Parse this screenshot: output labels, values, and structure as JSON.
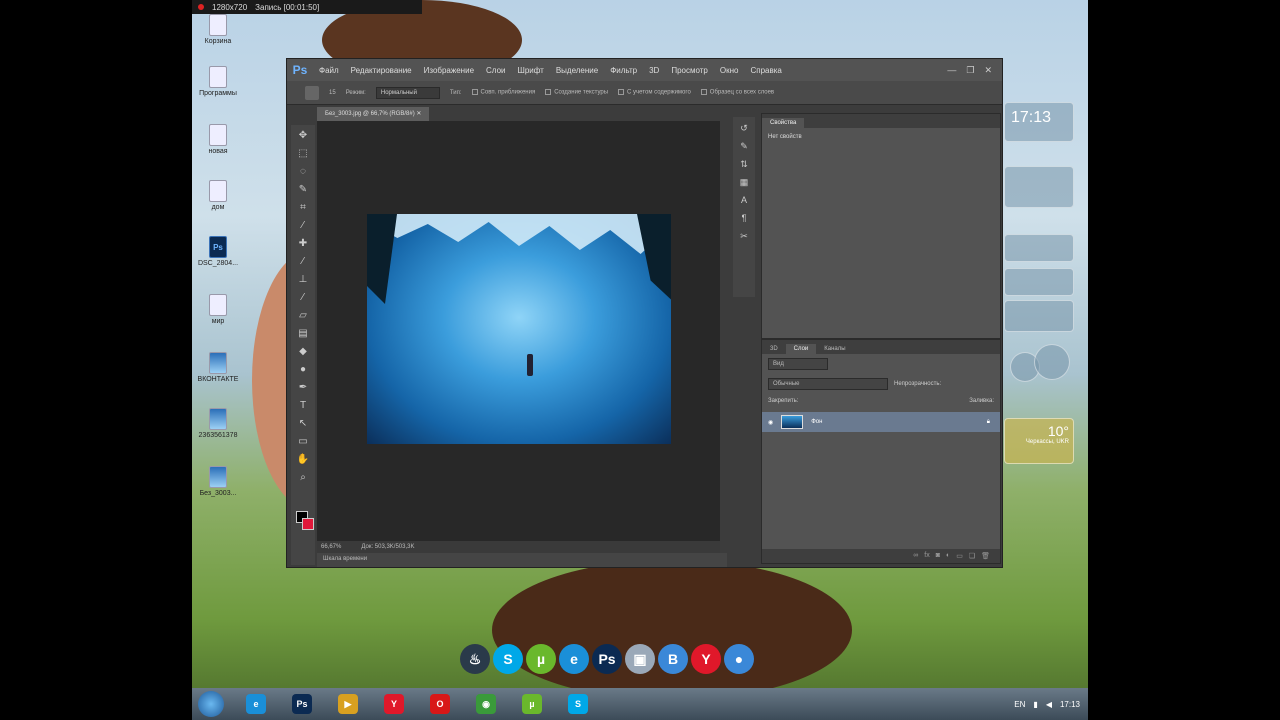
{
  "recorder": {
    "resolution": "1280x720",
    "status": "Запись [00:01:50]"
  },
  "desktop_icons": [
    {
      "label": "Корзина"
    },
    {
      "label": "Программы"
    },
    {
      "label": "новая"
    },
    {
      "label": "дом"
    },
    {
      "label": "DSC_2804..."
    },
    {
      "label": "мир"
    },
    {
      "label": "ВКОНТАКТЕ"
    },
    {
      "label": "2363561378"
    },
    {
      "label": "Без_3003..."
    }
  ],
  "photoshop": {
    "logo": "Ps",
    "menu": [
      "Файл",
      "Редактирование",
      "Изображение",
      "Слои",
      "Шрифт",
      "Выделение",
      "Фильтр",
      "3D",
      "Просмотр",
      "Окно",
      "Справка"
    ],
    "window_buttons": {
      "minimize": "—",
      "restore": "❐",
      "close": "✕"
    },
    "options": {
      "brush_size": "15",
      "mode_label": "Режим:",
      "mode_value": "Нормальный",
      "type_label": "Тип:",
      "check1": "Совп. приближения",
      "check2": "Создание текстуры",
      "check3": "С учетом содержимого",
      "check4": "Образец со всех слоев"
    },
    "doc_tab": "Без_3003.jpg @ 66,7% (RGB/8#) ✕",
    "status": {
      "zoom": "66,67%",
      "doc": "Док: 503,3K/503,3K"
    },
    "timeline_tab": "Шкала времени",
    "props_panel": {
      "tab": "Свойства",
      "body": "Нет свойств"
    },
    "layers_panel": {
      "tabs": [
        "3D",
        "Слои",
        "Каналы"
      ],
      "kind": "Вид",
      "blend": "Обычные",
      "opacity_label": "Непрозрачность:",
      "lock_label": "Закрепить:",
      "fill_label": "Заливка:",
      "layer_name": "Фон"
    }
  },
  "gadgets": {
    "clock": "17:13",
    "weather_temp": "10°",
    "weather_city": "Черкассы, UKR"
  },
  "dock": [
    {
      "icon": "steam-icon",
      "glyph": "♨",
      "color": "#2a3a4a"
    },
    {
      "icon": "skype-icon",
      "glyph": "S",
      "color": "#00a8e8"
    },
    {
      "icon": "utorrent-icon",
      "glyph": "µ",
      "color": "#6ab82c"
    },
    {
      "icon": "ie-icon",
      "glyph": "e",
      "color": "#1a8fd8"
    },
    {
      "icon": "photoshop-icon",
      "glyph": "Ps",
      "color": "#0b2a52"
    },
    {
      "icon": "camera-icon",
      "glyph": "▣",
      "color": "#9aa8b8"
    },
    {
      "icon": "vk-icon",
      "glyph": "B",
      "color": "#3a88d8"
    },
    {
      "icon": "yandex-icon",
      "glyph": "Y",
      "color": "#e0182a"
    },
    {
      "icon": "chat-icon",
      "glyph": "●",
      "color": "#3a88d8"
    }
  ],
  "taskbar": {
    "items": [
      {
        "icon": "ie-blue-icon",
        "glyph": "e",
        "color": "#1a8fd8"
      },
      {
        "icon": "photoshop-icon",
        "glyph": "Ps",
        "color": "#0b2a52"
      },
      {
        "icon": "media-icon",
        "glyph": "▶",
        "color": "#d8a020"
      },
      {
        "icon": "yandex-icon",
        "glyph": "Y",
        "color": "#e0182a"
      },
      {
        "icon": "opera-icon",
        "glyph": "O",
        "color": "#d81818"
      },
      {
        "icon": "chrome-icon",
        "glyph": "◉",
        "color": "#3a9a3a"
      },
      {
        "icon": "utorrent-icon",
        "glyph": "µ",
        "color": "#6ab82c"
      },
      {
        "icon": "skype-icon",
        "glyph": "S",
        "color": "#00a8e8"
      }
    ],
    "lang": "EN",
    "time": "17:13"
  }
}
